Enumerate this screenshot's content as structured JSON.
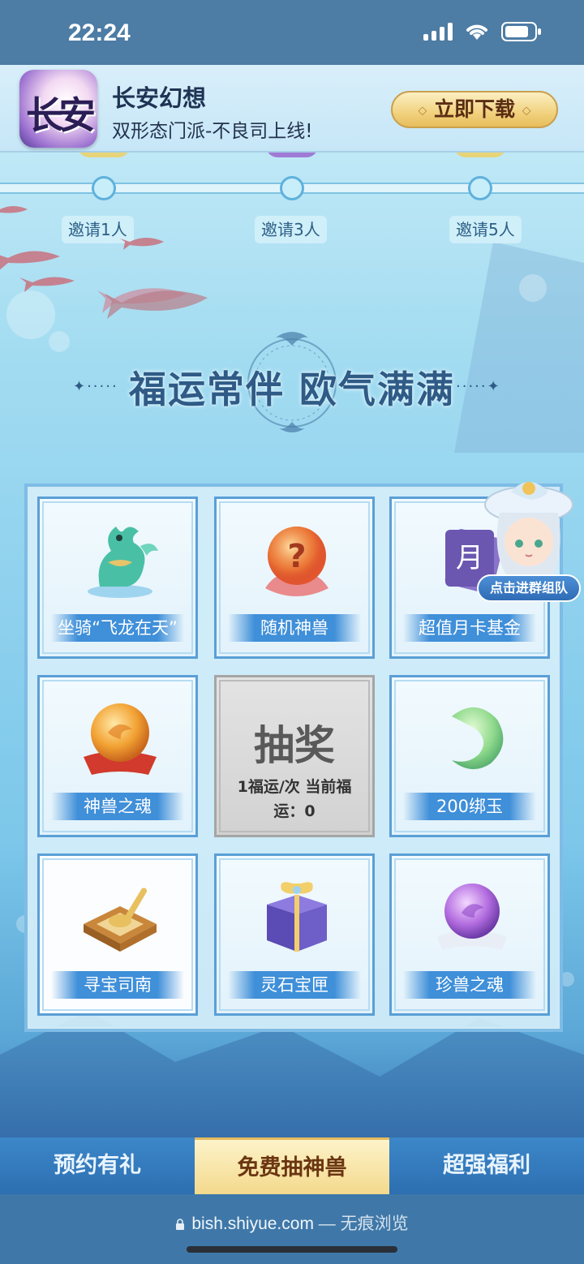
{
  "status_bar": {
    "time": "22:24"
  },
  "app_banner": {
    "icon_text": "长安",
    "app_name": "长安幻想",
    "description": "双形态门派-不良司上线!",
    "download_label": "立即下载"
  },
  "invite_progress": {
    "milestones": [
      {
        "label": "邀请1人"
      },
      {
        "label": "邀请3人"
      },
      {
        "label": "邀请5人"
      }
    ]
  },
  "section_title": "福运常伴 欧气满满",
  "prize_grid": {
    "prizes": [
      {
        "label": "坐骑“飞龙在天”",
        "icon": "dragon-mount-icon"
      },
      {
        "label": "随机神兽",
        "icon": "mystery-orb-icon"
      },
      {
        "label": "超值月卡基金",
        "icon": "month-card-icon"
      },
      {
        "label": "神兽之魂",
        "icon": "golden-orb-icon"
      },
      {
        "label": "200绑玉",
        "icon": "jade-icon"
      },
      {
        "label": "寻宝司南",
        "icon": "compass-spoon-icon"
      },
      {
        "label": "灵石宝匣",
        "icon": "gift-box-icon"
      },
      {
        "label": "珍兽之魂",
        "icon": "purple-orb-icon"
      }
    ],
    "draw": {
      "title": "抽奖",
      "cost_line": "1福运/次 当前福",
      "fortune_line": "运：0"
    }
  },
  "mascot_button": "点击进群组队",
  "tabs": [
    {
      "label": "预约有礼",
      "active": false
    },
    {
      "label": "免费抽神兽",
      "active": true
    },
    {
      "label": "超强福利",
      "active": false
    }
  ],
  "browser": {
    "domain": "bish.shiyue.com",
    "suffix": " — 无痕浏览"
  },
  "colors": {
    "accent_blue": "#3f8fd9",
    "gold": "#f1d27f",
    "title_blue": "#2f5b86"
  }
}
